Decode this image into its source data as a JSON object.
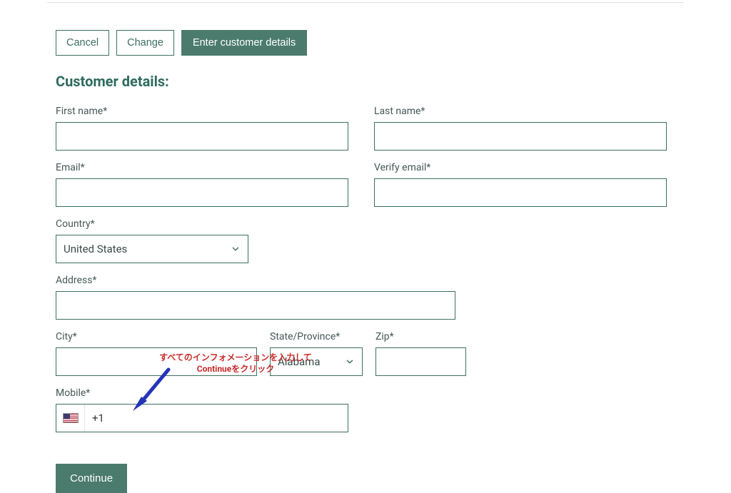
{
  "buttons": {
    "cancel": "Cancel",
    "change": "Change",
    "enter_details": "Enter customer details",
    "continue": "Continue"
  },
  "section_title": "Customer details:",
  "labels": {
    "first_name": "First name*",
    "last_name": "Last name*",
    "email": "Email*",
    "verify_email": "Verify email*",
    "country": "Country*",
    "address": "Address*",
    "city": "City*",
    "state": "State/Province*",
    "zip": "Zip*",
    "mobile": "Mobile*"
  },
  "values": {
    "first_name": "",
    "last_name": "",
    "email": "",
    "verify_email": "",
    "country": "United States",
    "address": "",
    "city": "",
    "state": "Alabama",
    "zip": "",
    "dial_code": "+1",
    "mobile": ""
  },
  "annotation": {
    "line1": "すべてのインフォメーションを入力して",
    "line2": "Continueをクリック"
  },
  "colors": {
    "accent": "#4b7b6d",
    "annotation": "#c92a2a",
    "arrow": "#2334b8"
  }
}
